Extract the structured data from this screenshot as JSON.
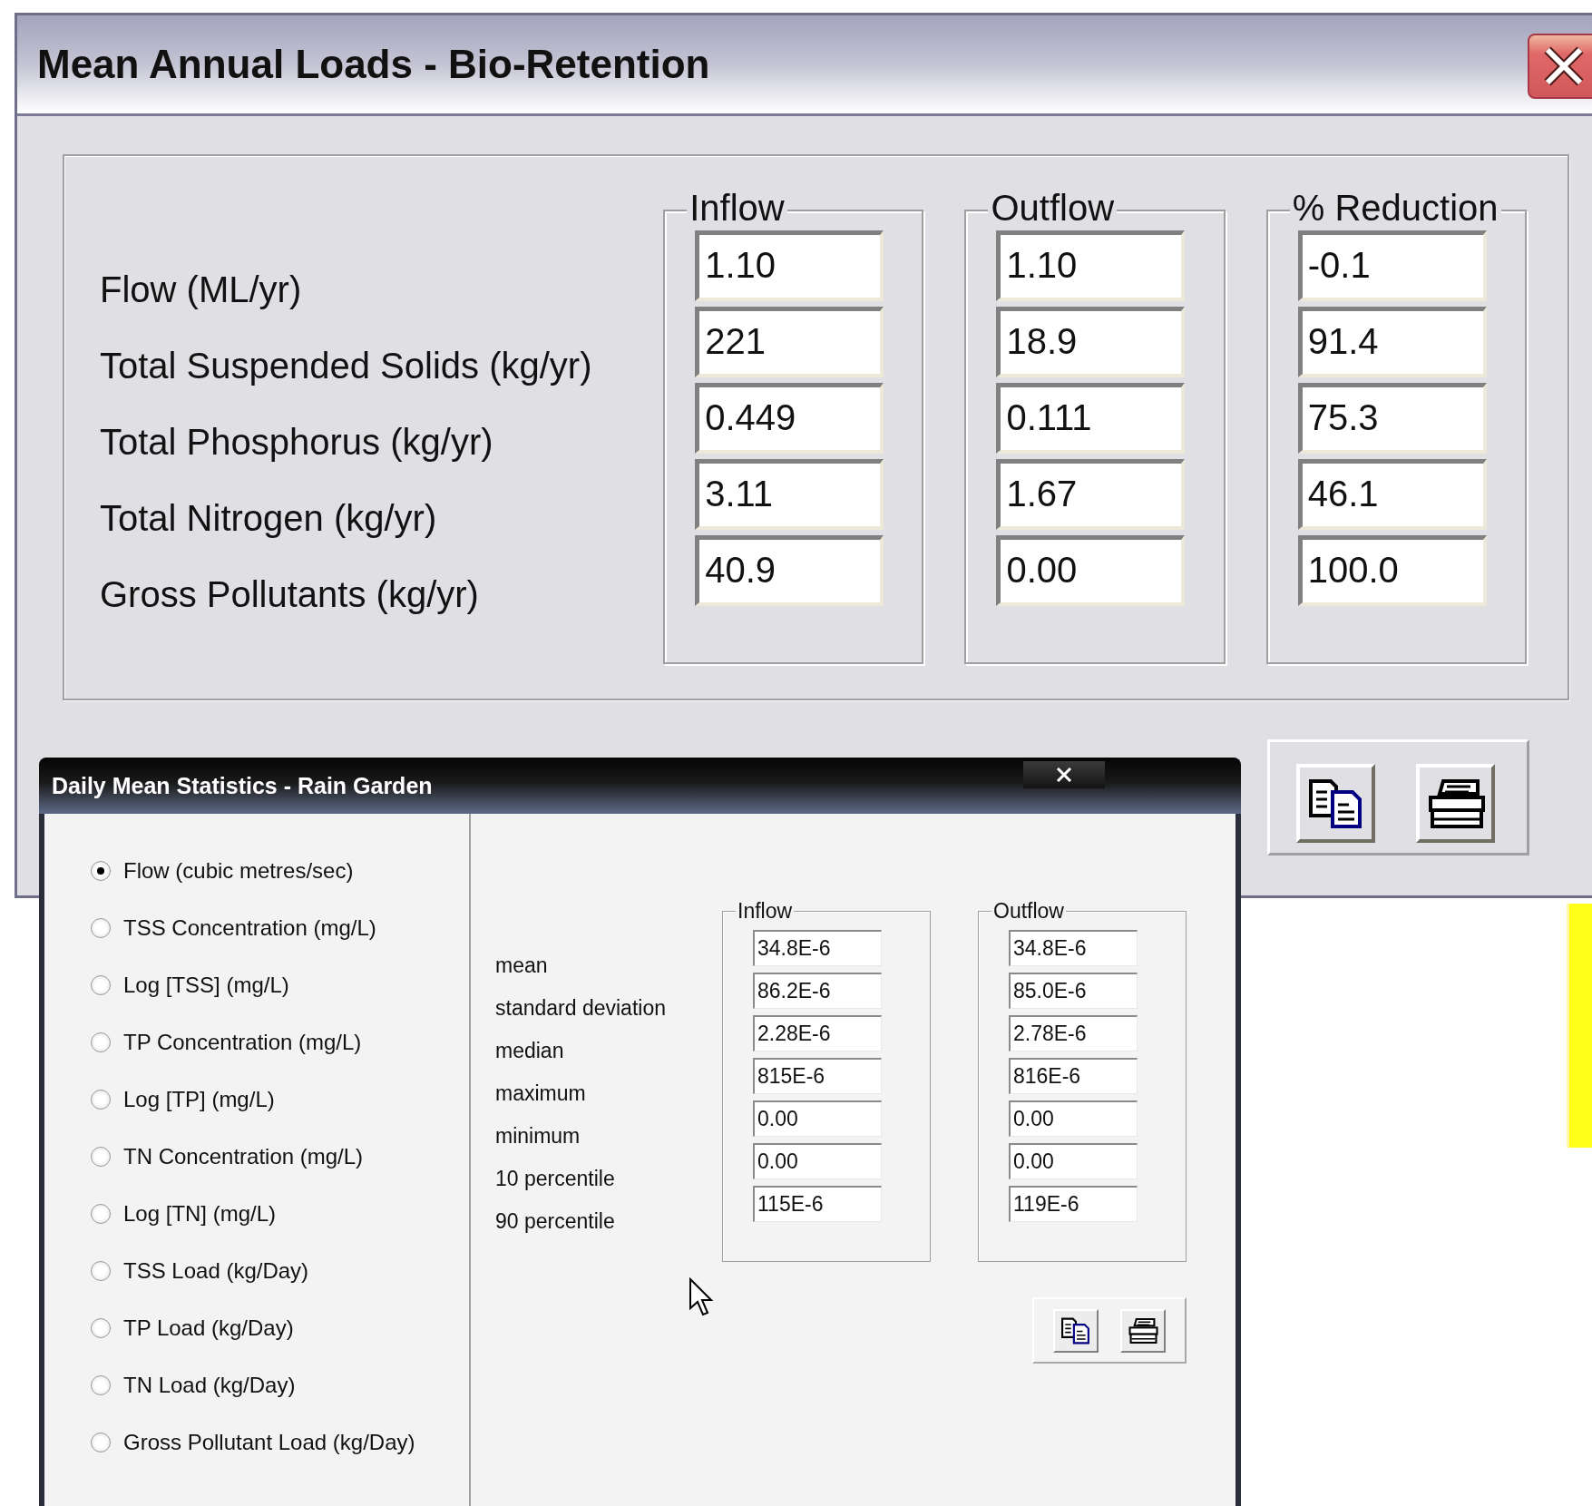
{
  "main_window": {
    "title": "Mean Annual Loads - Bio-Retention",
    "rows": [
      "Flow (ML/yr)",
      "Total Suspended Solids (kg/yr)",
      "Total Phosphorus (kg/yr)",
      "Total Nitrogen (kg/yr)",
      "Gross Pollutants (kg/yr)"
    ],
    "columns": [
      {
        "title": "Inflow",
        "values": [
          "1.10",
          "221",
          "0.449",
          "3.11",
          "40.9"
        ]
      },
      {
        "title": "Outflow",
        "values": [
          "1.10",
          "18.9",
          "0.111",
          "1.67",
          "0.00"
        ]
      },
      {
        "title": "% Reduction",
        "values": [
          "-0.1",
          "91.4",
          "75.3",
          "46.1",
          "100.0"
        ]
      }
    ]
  },
  "stats_window": {
    "title": "Daily Mean Statistics - Rain Garden",
    "options": [
      {
        "label": "Flow (cubic metres/sec)",
        "selected": true
      },
      {
        "label": "TSS Concentration (mg/L)",
        "selected": false
      },
      {
        "label": "Log [TSS] (mg/L)",
        "selected": false
      },
      {
        "label": "TP Concentration (mg/L)",
        "selected": false
      },
      {
        "label": "Log [TP] (mg/L)",
        "selected": false
      },
      {
        "label": "TN Concentration (mg/L)",
        "selected": false
      },
      {
        "label": "Log [TN] (mg/L)",
        "selected": false
      },
      {
        "label": "TSS Load (kg/Day)",
        "selected": false
      },
      {
        "label": "TP Load (kg/Day)",
        "selected": false
      },
      {
        "label": "TN Load (kg/Day)",
        "selected": false
      },
      {
        "label": "Gross Pollutant Load (kg/Day)",
        "selected": false
      }
    ],
    "stats": [
      "mean",
      "standard deviation",
      "median",
      "maximum",
      "minimum",
      "10 percentile",
      "90 percentile"
    ],
    "columns": [
      {
        "title": "Inflow",
        "values": [
          "34.8E-6",
          "86.2E-6",
          "2.28E-6",
          "815E-6",
          "0.00",
          "0.00",
          "115E-6"
        ]
      },
      {
        "title": "Outflow",
        "values": [
          "34.8E-6",
          "85.0E-6",
          "2.78E-6",
          "816E-6",
          "0.00",
          "0.00",
          "119E-6"
        ]
      }
    ]
  }
}
